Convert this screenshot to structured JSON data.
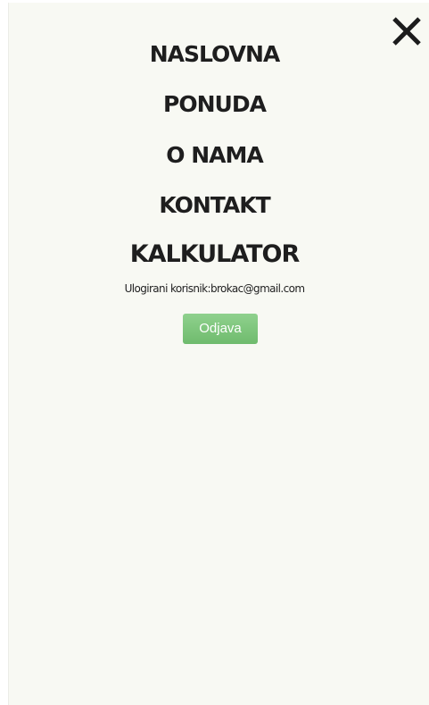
{
  "menu": {
    "items": [
      {
        "label": "NASLOVNA"
      },
      {
        "label": "PONUDA"
      },
      {
        "label": "O NAMA"
      },
      {
        "label": "KONTAKT"
      },
      {
        "label": "KALKULATOR"
      }
    ],
    "close_icon": "close-icon"
  },
  "user": {
    "label": "Ulogirani korisnik:",
    "email": "brokac@gmail.com"
  },
  "logout": {
    "label": "Odjava",
    "color": "#7ec67c"
  },
  "colors": {
    "background": "#f8f9f3",
    "text": "#1e1e1e"
  }
}
